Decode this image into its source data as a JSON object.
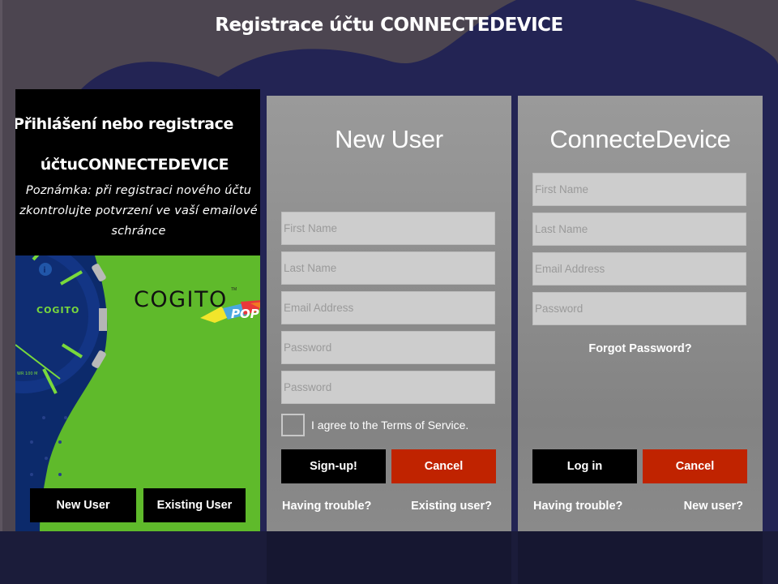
{
  "page": {
    "title": "Registrace účtu CONNECTEDEVICE"
  },
  "colors": {
    "background": "#4c4550",
    "wave": "#232454",
    "brand_green": "#5fba2b",
    "cancel_red": "#c02300",
    "button_black": "#000000"
  },
  "left_panel": {
    "title_line1": "Přihlášení nebo registrace",
    "title_line2": "účtuCONNECTEDEVICE",
    "note_line1": "Poznámka: při registraci nového účtu",
    "note_line2": "zkontrolujte potvrzení ve vaší emailové",
    "note_line3": "schránce",
    "watch_dial_brand": "COGITO",
    "watch_dial_text": "WR 100 M",
    "logo_text": "COGITO",
    "logo_tm": "TM",
    "logo_sub": "POP",
    "buttons": {
      "new_user": "New User",
      "existing_user": "Existing User"
    }
  },
  "new_user_form": {
    "title": "New User",
    "fields": {
      "first_name": {
        "placeholder": "First Name",
        "value": ""
      },
      "last_name": {
        "placeholder": "Last Name",
        "value": ""
      },
      "email": {
        "placeholder": "Email Address",
        "value": ""
      },
      "password": {
        "placeholder": "Password",
        "value": ""
      },
      "password_confirm": {
        "placeholder": "Password",
        "value": ""
      }
    },
    "terms_label": "I agree to the Terms of Service.",
    "terms_checked": false,
    "signup_button": "Sign-up!",
    "cancel_button": "Cancel",
    "trouble_link": "Having trouble?",
    "existing_link": "Existing user?"
  },
  "login_form": {
    "title": "ConnecteDevice",
    "fields": {
      "first_name": {
        "placeholder": "First Name",
        "value": ""
      },
      "last_name": {
        "placeholder": "Last Name",
        "value": ""
      },
      "email": {
        "placeholder": "Email Address",
        "value": ""
      },
      "password": {
        "placeholder": "Password",
        "value": ""
      }
    },
    "forgot_link": "Forgot Password?",
    "login_button": "Log in",
    "cancel_button": "Cancel",
    "trouble_link": "Having trouble?",
    "new_user_link": "New user?"
  }
}
